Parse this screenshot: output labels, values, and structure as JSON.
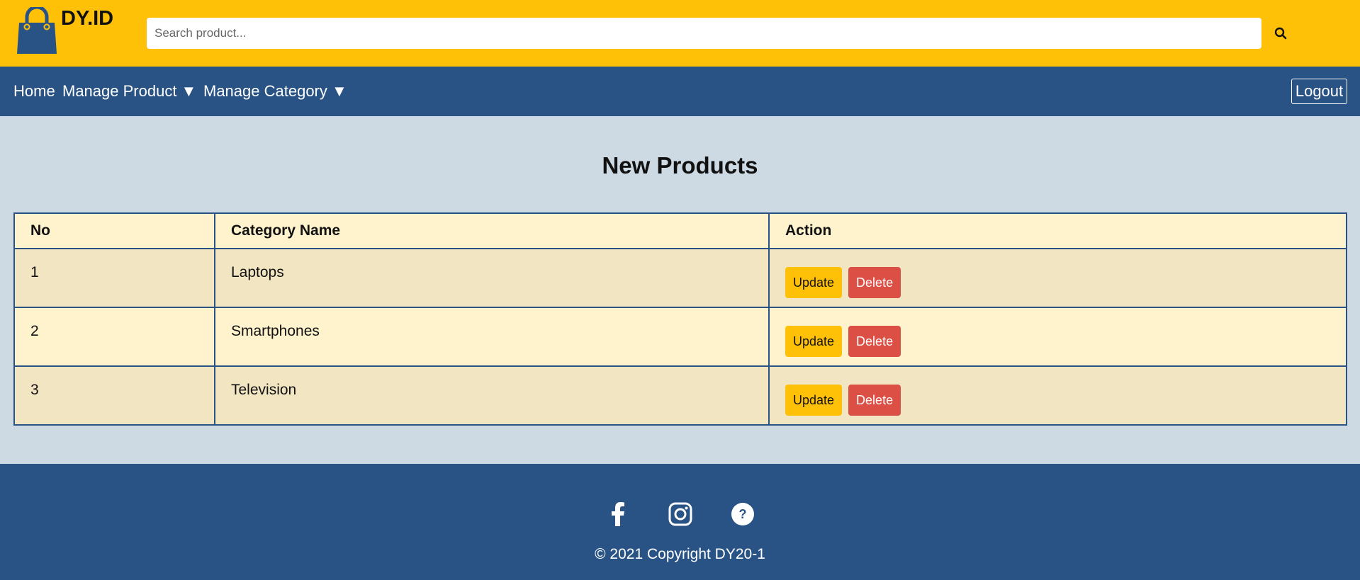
{
  "header": {
    "brand": "DY.ID",
    "search_placeholder": "Search product...",
    "search_icon": "search-icon",
    "logo_icon": "shopping-bag-icon"
  },
  "nav": {
    "home": "Home",
    "manage_product": "Manage Product ▼",
    "manage_category": "Manage Category ▼",
    "logout": "Logout"
  },
  "main": {
    "title": "New Products",
    "table": {
      "columns": [
        "No",
        "Category Name",
        "Action"
      ],
      "rows": [
        {
          "no": "1",
          "name": "Laptops"
        },
        {
          "no": "2",
          "name": "Smartphones"
        },
        {
          "no": "3",
          "name": "Television"
        }
      ],
      "update_label": "Update",
      "delete_label": "Delete"
    }
  },
  "footer": {
    "icons": [
      "facebook-icon",
      "instagram-icon",
      "help-icon"
    ],
    "copyright": "© 2021 Copyright DY20-1"
  },
  "colors": {
    "header_bg": "#ffc107",
    "nav_bg": "#295385",
    "page_bg": "#cdd9e3",
    "row_odd": "#f2e6c2",
    "row_even": "#fff3cd",
    "delete": "#dc4f45"
  }
}
